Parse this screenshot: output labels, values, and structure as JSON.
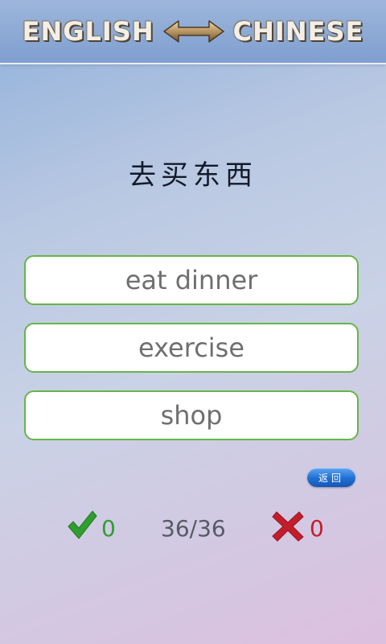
{
  "header": {
    "left_label": "ENGLISH",
    "right_label": "CHINESE",
    "arrow_icon": "double-arrow-icon"
  },
  "prompt": {
    "word": "去买东西"
  },
  "options": [
    {
      "label": "eat dinner"
    },
    {
      "label": "exercise"
    },
    {
      "label": "shop"
    }
  ],
  "back_button": {
    "label": "返回"
  },
  "score": {
    "correct": "0",
    "progress": "36/36",
    "wrong": "0",
    "correct_icon": "check-icon",
    "wrong_icon": "cross-icon"
  },
  "colors": {
    "option_border": "#68b447",
    "correct": "#2f9e2f",
    "wrong": "#c41d2a",
    "back_button": "#1f6fd3"
  }
}
